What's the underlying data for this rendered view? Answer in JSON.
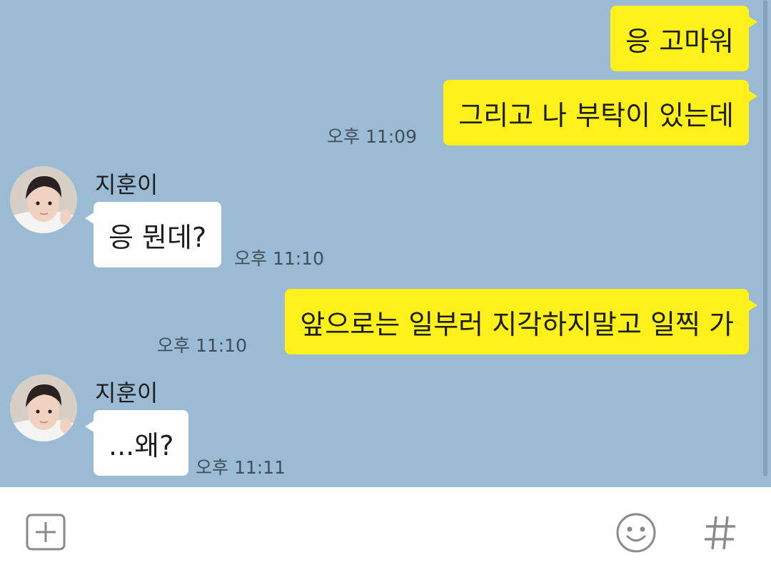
{
  "chat": {
    "messages": [
      {
        "side": "mine",
        "text": "응 고마워",
        "time": ""
      },
      {
        "side": "mine",
        "text": "그리고 나 부탁이 있는데",
        "time": "오후 11:09"
      },
      {
        "side": "theirs",
        "sender": "지훈이",
        "text": "응 뭔데?",
        "time": "오후 11:10"
      },
      {
        "side": "mine",
        "text": "앞으로는 일부러 지각하지말고 일찍 가",
        "time": "오후 11:10"
      },
      {
        "side": "theirs",
        "sender": "지훈이",
        "text": "...왜?",
        "time": "오후 11:11"
      }
    ]
  },
  "input_bar": {
    "add_icon": "plus-square-icon",
    "emoji_icon": "smiley-icon",
    "hashtag_icon": "hash-icon"
  },
  "colors": {
    "chat_background": "#9bbbd4",
    "my_bubble": "#fef01b",
    "their_bubble": "#ffffff",
    "icon_gray": "#8a8a8a"
  }
}
